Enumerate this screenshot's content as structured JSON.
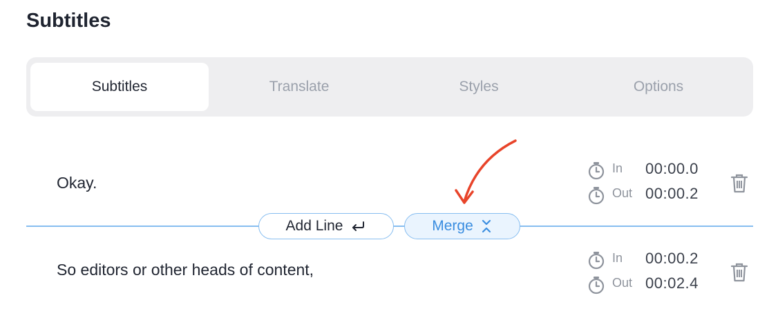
{
  "page": {
    "title": "Subtitles"
  },
  "tabs": [
    {
      "label": "Subtitles",
      "active": true
    },
    {
      "label": "Translate",
      "active": false
    },
    {
      "label": "Styles",
      "active": false
    },
    {
      "label": "Options",
      "active": false
    }
  ],
  "subtitles": [
    {
      "text": "Okay.",
      "in_label": "In",
      "in_time": "00:00.0",
      "out_label": "Out",
      "out_time": "00:00.2"
    },
    {
      "text": "So editors or other heads of content,",
      "in_label": "In",
      "in_time": "00:00.2",
      "out_label": "Out",
      "out_time": "00:02.4"
    }
  ],
  "actions": {
    "add_line_label": "Add Line",
    "merge_label": "Merge"
  },
  "colors": {
    "accent": "#86bdf0",
    "merge_text": "#3a8de0",
    "annotation_arrow": "#e8442a",
    "tab_bg": "#eeeef0"
  }
}
